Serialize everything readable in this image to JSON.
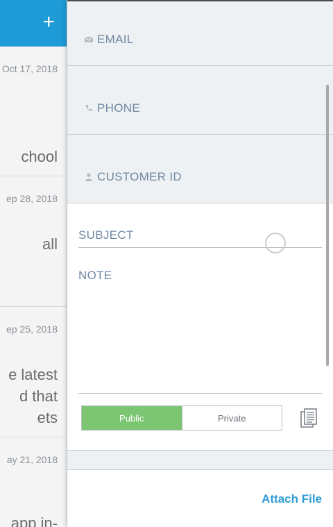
{
  "ticket_list": {
    "add_label": "+",
    "items": [
      {
        "date": "Oct 17, 2018",
        "snippet": [
          "chool"
        ]
      },
      {
        "date": "ep 28, 2018",
        "snippet": [
          "all"
        ]
      },
      {
        "date": "ep 25, 2018",
        "snippet": [
          "e latest",
          "d that",
          "ets"
        ]
      },
      {
        "date": "ay 21, 2018",
        "snippet": [
          "app in-"
        ]
      }
    ]
  },
  "form": {
    "email_label": "EMAIL",
    "phone_label": "PHONE",
    "customer_id_label": "CUSTOMER ID",
    "subject_label": "SUBJECT",
    "note_label": "NOTE",
    "visibility": {
      "public": "Public",
      "private": "Private",
      "selected": "Public"
    },
    "attach_label": "Attach File"
  },
  "colors": {
    "accent": "#1e9ad6",
    "public_selected": "#7cc573",
    "label": "#7088a2",
    "link": "#2d9bd3"
  },
  "icons": {
    "email": "envelope-icon",
    "phone": "phone-icon",
    "customer": "person-icon",
    "template": "documents-icon"
  }
}
